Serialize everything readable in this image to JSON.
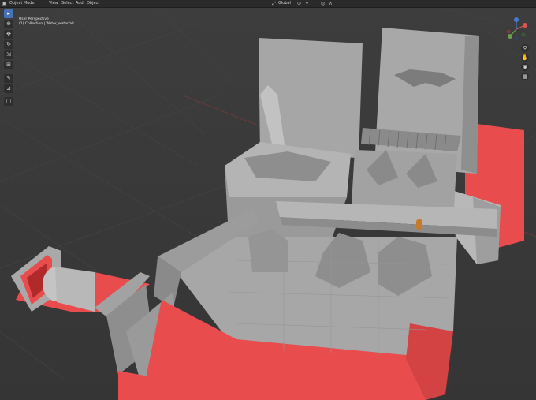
{
  "header": {
    "mode_label": "Object Mode",
    "menus": [
      "View",
      "Select",
      "Add",
      "Object"
    ],
    "orientation_label": "Global"
  },
  "viewport_info": {
    "view_name": "User Perspective",
    "collection_path": "(1) Collection | Water_waterfall"
  },
  "toolbar": {
    "tools": [
      "select",
      "cursor",
      "move",
      "rotate",
      "scale",
      "transform",
      "annotate",
      "measure",
      "add-cube"
    ]
  },
  "nav": {
    "buttons": [
      "zoom",
      "pan",
      "camera",
      "grid-view"
    ]
  },
  "gizmo": {
    "axes": [
      "X",
      "Y",
      "Z"
    ]
  },
  "colors": {
    "viewport_bg": "#3a3a3a",
    "mesh_gray": "#9a9a9a",
    "mesh_red": "#e84c4c",
    "header_bg": "#2a2a2a",
    "active_tool": "#4772b3"
  }
}
